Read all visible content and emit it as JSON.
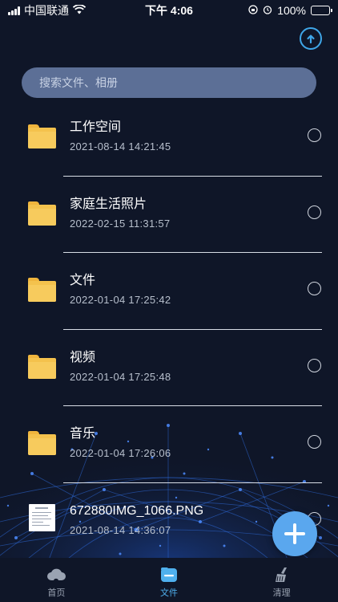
{
  "status_bar": {
    "carrier": "中国联通",
    "time": "下午 4:06",
    "battery": "100%",
    "signal_icon": "signal-icon",
    "wifi_icon": "wifi-icon",
    "alarm_icon": "alarm-icon",
    "rotation_lock_icon": "rotation-lock-icon"
  },
  "header": {
    "action_icon": "upload-cloud-icon"
  },
  "search": {
    "placeholder": "搜索文件、相册"
  },
  "files": [
    {
      "name": "工作空间",
      "date": "2021-08-14 14:21:45",
      "type": "folder",
      "icon": "folder-icon"
    },
    {
      "name": "家庭生活照片",
      "date": "2022-02-15 11:31:57",
      "type": "folder",
      "icon": "folder-icon"
    },
    {
      "name": "文件",
      "date": "2022-01-04 17:25:42",
      "type": "folder",
      "icon": "folder-icon"
    },
    {
      "name": "视频",
      "date": "2022-01-04 17:25:48",
      "type": "folder",
      "icon": "folder-icon"
    },
    {
      "name": "音乐",
      "date": "2022-01-04 17:26:06",
      "type": "folder",
      "icon": "folder-icon"
    },
    {
      "name": "672880IMG_1066.PNG",
      "date": "2021-08-14 14:36:07",
      "type": "image",
      "icon": "image-thumbnail"
    }
  ],
  "fab": {
    "icon": "plus-icon"
  },
  "tabbar": {
    "tabs": [
      {
        "label": "首页",
        "icon": "cloud-home-icon",
        "active": false
      },
      {
        "label": "文件",
        "icon": "folder-tab-icon",
        "active": true
      },
      {
        "label": "清理",
        "icon": "broom-icon",
        "active": false
      }
    ]
  },
  "colors": {
    "background": "#0f1628",
    "search_bg": "#5c6f96",
    "accent": "#4fb0ee",
    "folder": "#f4c24d",
    "fab": "#5aa7ee"
  }
}
